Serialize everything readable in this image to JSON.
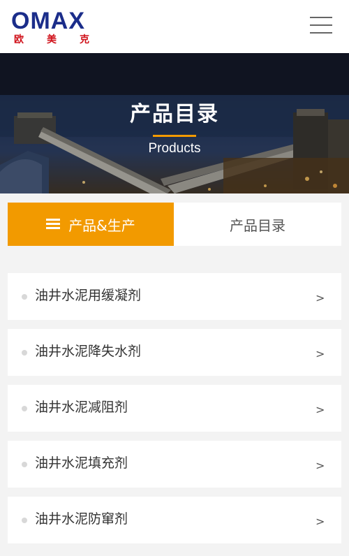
{
  "header": {
    "logo_text": "OMAX",
    "logo_cn": [
      "欧",
      "美",
      "克"
    ]
  },
  "banner": {
    "title": "产品目录",
    "subtitle": "Products"
  },
  "tabs": {
    "active_label": "产品&生产",
    "inactive_label": "产品目录"
  },
  "products": [
    {
      "name": "油井水泥用缓凝剂",
      "arrow": ">"
    },
    {
      "name": "油井水泥降失水剂",
      "arrow": ">"
    },
    {
      "name": "油井水泥减阻剂",
      "arrow": ">"
    },
    {
      "name": "油井水泥填充剂",
      "arrow": ">"
    },
    {
      "name": "油井水泥防窜剂",
      "arrow": ">"
    }
  ],
  "colors": {
    "accent": "#f29a00",
    "brand_blue": "#1b2d8a",
    "brand_red": "#d0121b"
  }
}
